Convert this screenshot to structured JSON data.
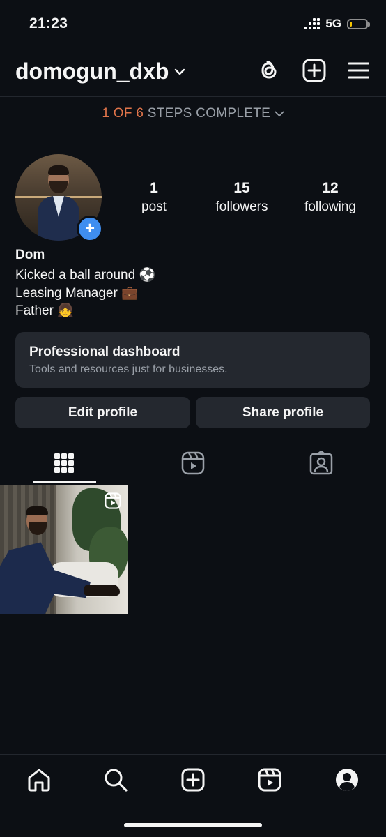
{
  "status_bar": {
    "time": "21:23",
    "network": "5G",
    "battery_level": 0.15,
    "battery_color": "#f5c400"
  },
  "header": {
    "username": "domogun_dxb",
    "icons": [
      "threads-icon",
      "new-post-icon",
      "menu-icon"
    ]
  },
  "steps": {
    "progress": "1 OF 6",
    "label": "STEPS COMPLETE"
  },
  "profile": {
    "stats": [
      {
        "value": "1",
        "label": "post"
      },
      {
        "value": "15",
        "label": "followers"
      },
      {
        "value": "12",
        "label": "following"
      }
    ],
    "name": "Dom",
    "bio": [
      {
        "text": "Kicked a ball around",
        "emoji": "⚽"
      },
      {
        "text": "Leasing Manager",
        "emoji": "💼"
      },
      {
        "text": "Father",
        "emoji": "👧"
      }
    ]
  },
  "dashboard": {
    "title": "Professional dashboard",
    "subtitle": "Tools and resources just for businesses."
  },
  "buttons": {
    "edit": "Edit profile",
    "share": "Share profile"
  },
  "tabs": [
    "grid-icon",
    "reels-icon",
    "tagged-icon"
  ],
  "bottom_nav": [
    "home-icon",
    "search-icon",
    "create-icon",
    "reels-icon",
    "profile-icon"
  ],
  "colors": {
    "accent": "#e0744a",
    "badge_blue": "#3f8ef0",
    "background": "#0c0f14",
    "card": "#24282f"
  }
}
